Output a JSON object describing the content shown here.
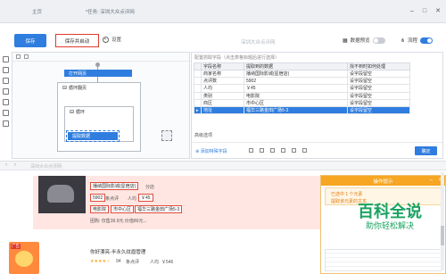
{
  "tabs": [
    {
      "label": "主页"
    },
    {
      "label": "*任务: 深圳大众点评网"
    }
  ],
  "toolbar": {
    "save_label": "保存",
    "save_start_label": "保存并启动",
    "settings_label": "设置",
    "task_title": "深圳大众点评网",
    "data_preview_label": "数据预览",
    "flow_label": "流程"
  },
  "flow": {
    "nodes": [
      "打开网页",
      "循环翻页",
      "循环",
      "提取数据"
    ]
  },
  "grid": {
    "config_hint": "配置抓取字段（点击表格标题后进行选择）",
    "headers": [
      "字段名称",
      "提取到的数据",
      "找不到时如何处理"
    ],
    "rows": [
      {
        "name": "商家名称",
        "value": "播纳国际影城(星宿店)",
        "action": "设字段留空"
      },
      {
        "name": "点评数",
        "value": "5902",
        "action": "设字段留空"
      },
      {
        "name": "人均",
        "value": "￥45",
        "action": "设字段留空"
      },
      {
        "name": "类别",
        "value": "电影院",
        "action": "设字段留空"
      },
      {
        "name": "商区",
        "value": "市中心区",
        "action": "设字段留空"
      },
      {
        "name": "地址",
        "value": "福华三路金田广场5-3",
        "action": "设字段留空"
      }
    ],
    "selected_row": 5,
    "advanced_label": "高级选项",
    "add_field_label": "添加特殊字段",
    "confirm_label": "确定"
  },
  "browser": {
    "address": "深圳大众点评网"
  },
  "listing": {
    "shop_name": "播纳国际影城(星宿店)",
    "branch": "分店",
    "reviews": "5902",
    "reviews_unit": "条点评",
    "price_label": "人均",
    "price": "￥45",
    "category": "电影院",
    "district": "市中心区",
    "address": "福华三路金田广场5-3",
    "discount": "团购: 仅售39.9元 价值80元...",
    "second_name": "你好漂亮-半永久纹眉管理",
    "second_reviews": "94",
    "second_reviews_unit": "条点评",
    "second_price_label": "人均",
    "second_price": "￥546",
    "ad_badge": "广告"
  },
  "tips": {
    "title": "操作提示",
    "line1": "已选中 1 个元素",
    "line2": "提取该元素的文本"
  },
  "watermark": {
    "main": "百科全说",
    "sub": "助你轻松解决"
  },
  "colors": {
    "primary": "#2f7ddf",
    "highlight_border": "#e0392c",
    "tips_header": "#f6a623",
    "watermark": "#1aa260"
  }
}
